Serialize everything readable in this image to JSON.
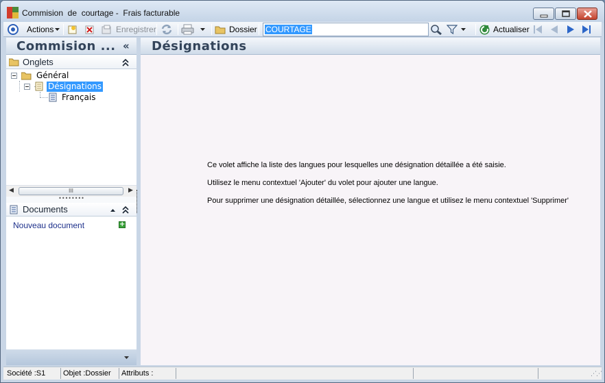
{
  "window": {
    "title": "Commision  de  courtage -  Frais facturable",
    "controls": {
      "minimize": "minimize",
      "maximize": "maximize",
      "close": "close"
    }
  },
  "toolbar": {
    "actions_label": "Actions",
    "save_label": "Enregistrer",
    "folder_label": "Dossier",
    "search_value": "COURTAGE",
    "refresh_label": "Actualiser"
  },
  "left_panel": {
    "title": "Commision   ...",
    "collapse_glyph": "«",
    "tabs_section": {
      "label": "Onglets"
    },
    "tree": {
      "root": "Général",
      "child": "Désignations",
      "leaf": "Français"
    },
    "scroll_grip": "III",
    "splitter_grip": "••••••••",
    "documents_section": {
      "label": "Documents",
      "new_document": "Nouveau document"
    }
  },
  "main": {
    "title": "Désignations",
    "info_lines": [
      "Ce volet affiche la liste des langues pour lesquelles une désignation détaillée a été saisie.",
      "Utilisez le menu contextuel 'Ajouter' du volet pour ajouter une langue.",
      "Pour supprimer une désignation détaillée, sélectionnez une langue et utilisez le menu contextuel 'Supprimer'"
    ]
  },
  "status": {
    "societe": "Société :S1",
    "objet": "Objet :Dossier",
    "attributs": "Attributs :"
  },
  "colors": {
    "selection": "#3399ff",
    "header_text": "#33445a",
    "link": "#1c2f8a",
    "close_button": "#c4432d",
    "content_bg": "#f8f4f8"
  }
}
